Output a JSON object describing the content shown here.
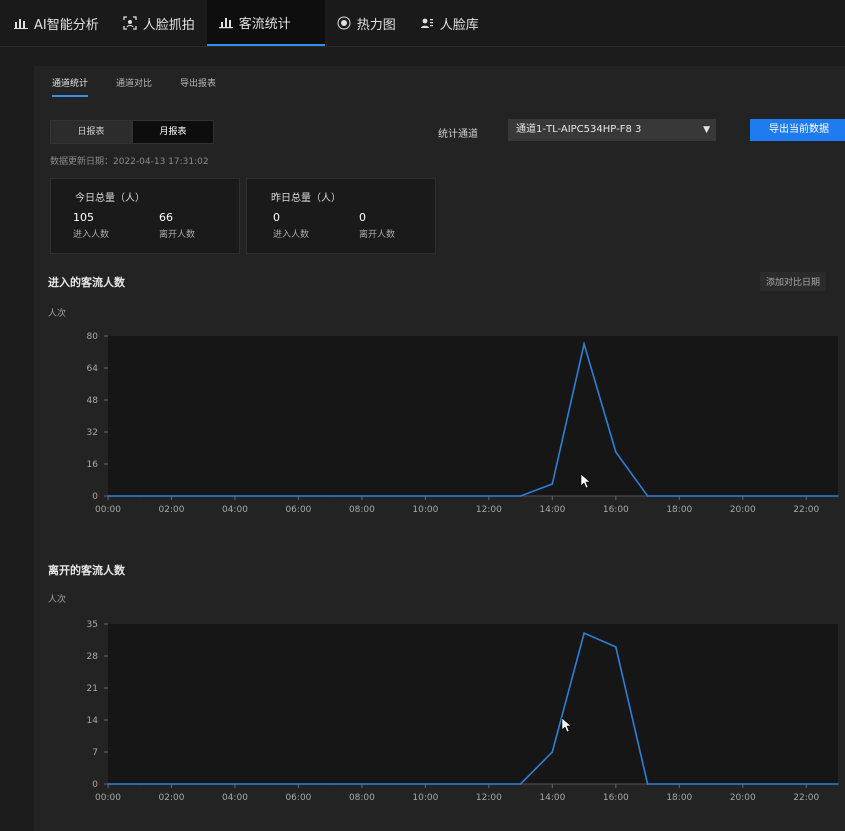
{
  "nav": {
    "items": [
      {
        "label": "AI智能分析",
        "icon": "ai-chart-icon",
        "active": false
      },
      {
        "label": "人脸抓拍",
        "icon": "face-capture-icon",
        "active": false
      },
      {
        "label": "客流统计",
        "icon": "bar-chart-icon",
        "active": true
      },
      {
        "label": "热力图",
        "icon": "heatmap-icon",
        "active": false
      },
      {
        "label": "人脸库",
        "icon": "face-library-icon",
        "active": false
      }
    ]
  },
  "subtabs": [
    "通道统计",
    "通道对比",
    "导出报表"
  ],
  "report_type": {
    "daily": "日报表",
    "monthly": "月报表",
    "selected": "月报表"
  },
  "channel": {
    "label": "统计通道",
    "value": "通道1-TL-AIPC534HP-F8 3"
  },
  "export_button": "导出当前数据",
  "updated": "数据更新日期：2022-04-13 17:31:02",
  "cards": {
    "today": {
      "title": "今日总量（人）",
      "enter": "105",
      "leave": "66",
      "enter_label": "进入人数",
      "leave_label": "离开人数"
    },
    "yesterday": {
      "title": "昨日总量（人）",
      "enter": "0",
      "leave": "0",
      "enter_label": "进入人数",
      "leave_label": "离开人数"
    }
  },
  "compare_button": "添加对比日期",
  "colors": {
    "accent": "#1f7cf0",
    "line": "#2e7fd6"
  },
  "chart_data": [
    {
      "type": "line",
      "title": "进入的客流人数",
      "ylabel": "人次",
      "x": [
        "00:00",
        "01:00",
        "02:00",
        "03:00",
        "04:00",
        "05:00",
        "06:00",
        "07:00",
        "08:00",
        "09:00",
        "10:00",
        "11:00",
        "12:00",
        "13:00",
        "14:00",
        "15:00",
        "16:00",
        "17:00",
        "18:00",
        "19:00",
        "20:00",
        "21:00",
        "22:00",
        "23:00"
      ],
      "xticks": [
        "00:00",
        "02:00",
        "04:00",
        "06:00",
        "08:00",
        "10:00",
        "12:00",
        "14:00",
        "16:00",
        "18:00",
        "20:00",
        "22:00"
      ],
      "yticks": [
        0,
        16,
        32,
        48,
        64,
        80
      ],
      "ylim": [
        0,
        80
      ],
      "values": [
        0,
        0,
        0,
        0,
        0,
        0,
        0,
        0,
        0,
        0,
        0,
        0,
        0,
        0,
        6,
        76,
        22,
        0,
        0,
        0,
        0,
        0,
        0,
        0
      ]
    },
    {
      "type": "line",
      "title": "离开的客流人数",
      "ylabel": "人次",
      "x": [
        "00:00",
        "01:00",
        "02:00",
        "03:00",
        "04:00",
        "05:00",
        "06:00",
        "07:00",
        "08:00",
        "09:00",
        "10:00",
        "11:00",
        "12:00",
        "13:00",
        "14:00",
        "15:00",
        "16:00",
        "17:00",
        "18:00",
        "19:00",
        "20:00",
        "21:00",
        "22:00",
        "23:00"
      ],
      "xticks": [
        "00:00",
        "02:00",
        "04:00",
        "06:00",
        "08:00",
        "10:00",
        "12:00",
        "14:00",
        "16:00",
        "18:00",
        "20:00",
        "22:00"
      ],
      "yticks": [
        0,
        7,
        14,
        21,
        28,
        35
      ],
      "ylim": [
        0,
        35
      ],
      "values": [
        0,
        0,
        0,
        0,
        0,
        0,
        0,
        0,
        0,
        0,
        0,
        0,
        0,
        0,
        7,
        33,
        30,
        0,
        0,
        0,
        0,
        0,
        0,
        0
      ]
    }
  ]
}
